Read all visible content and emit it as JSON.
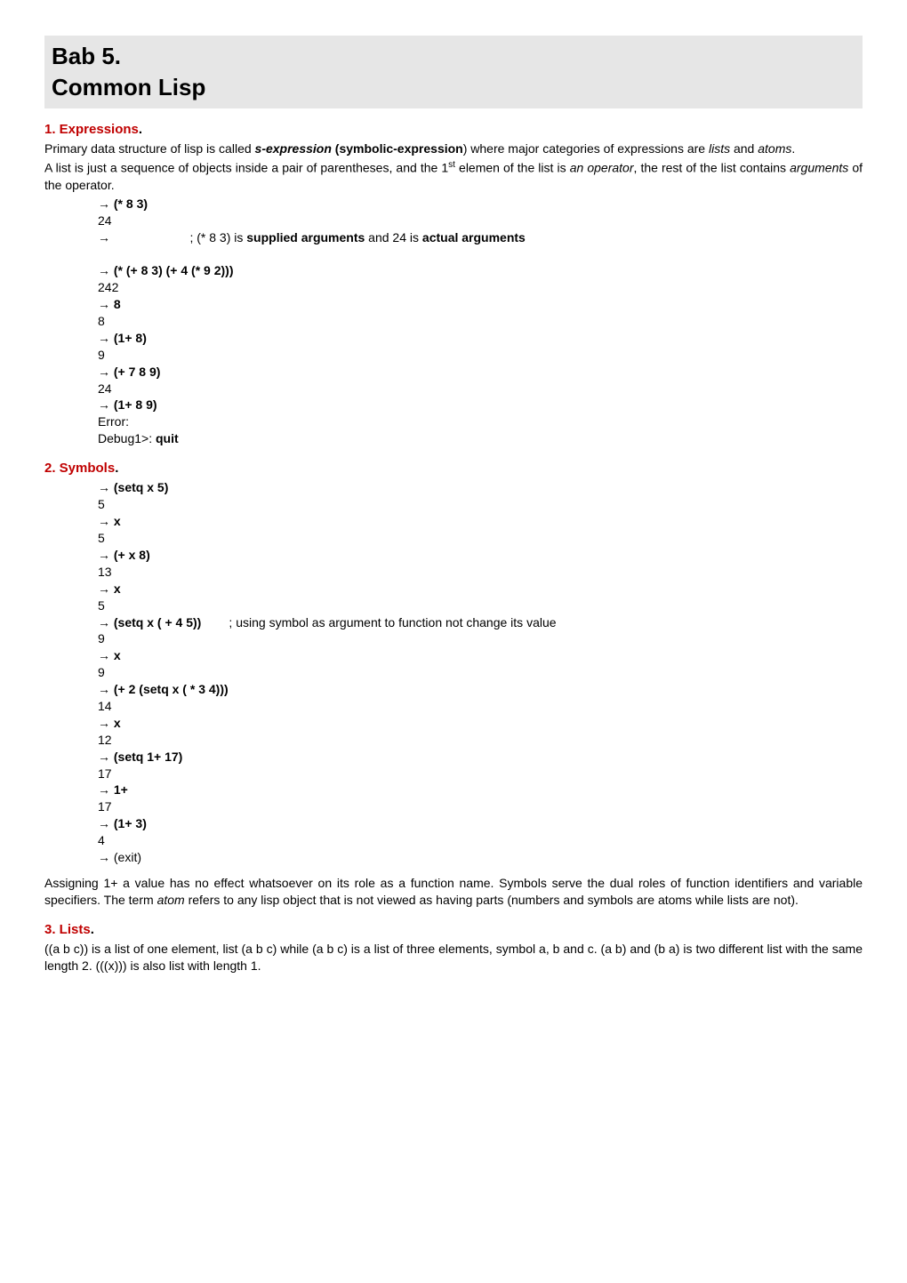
{
  "title": {
    "line1": "Bab 5.",
    "line2": "Common Lisp"
  },
  "s1": {
    "heading": "1. Expressions",
    "p1a": "Primary data structure of lisp is called ",
    "p1b": "s-expression",
    "p1c": " (symbolic-expression",
    "p1d": ") where major categories of expressions are ",
    "p1e": "lists",
    "p1f": " and ",
    "p1g": "atoms",
    "p1h": ".",
    "p2a": "A list is just a sequence of objects inside a pair of parentheses, and the 1",
    "p2b": "st",
    "p2c": " elemen of the list is ",
    "p2d": "an operator",
    "p2e": ", the rest of the list contains ",
    "p2f": "arguments",
    "p2g": " of the operator.",
    "code": [
      {
        "pre": "→ ",
        "b": "(* 8 3)",
        "post": ""
      },
      {
        "pre": "24",
        "b": "",
        "post": ""
      },
      {
        "pre": "→                       ; (* 8 3) is ",
        "b": "supplied arguments",
        "post": " and 24 is ",
        "b2": "actual arguments"
      },
      {
        "pre": "",
        "b": "",
        "post": ""
      },
      {
        "pre": "→ ",
        "b": "(* (+ 8 3) (+ 4 (* 9 2)))",
        "post": ""
      },
      {
        "pre": "242",
        "b": "",
        "post": ""
      },
      {
        "pre": "→ ",
        "b": "8",
        "post": ""
      },
      {
        "pre": "8",
        "b": "",
        "post": ""
      },
      {
        "pre": "→ ",
        "b": "(1+ 8)",
        "post": ""
      },
      {
        "pre": "9",
        "b": "",
        "post": ""
      },
      {
        "pre": "→ ",
        "b": "(+ 7 8 9)",
        "post": ""
      },
      {
        "pre": "24",
        "b": "",
        "post": ""
      },
      {
        "pre": "→ ",
        "b": "(1+ 8 9)",
        "post": ""
      },
      {
        "pre": "Error:",
        "b": "",
        "post": ""
      },
      {
        "pre": "Debug1>: ",
        "b": "quit",
        "post": ""
      }
    ]
  },
  "s2": {
    "heading": "2. Symbols",
    "code": [
      {
        "pre": "→ ",
        "b": "(setq x 5)",
        "post": ""
      },
      {
        "pre": "5",
        "b": "",
        "post": ""
      },
      {
        "pre": "→ ",
        "b": "x",
        "post": ""
      },
      {
        "pre": "5",
        "b": "",
        "post": ""
      },
      {
        "pre": "→ ",
        "b": "(+ x 8)",
        "post": ""
      },
      {
        "pre": "13",
        "b": "",
        "post": ""
      },
      {
        "pre": "→ ",
        "b": "x",
        "post": ""
      },
      {
        "pre": "5",
        "b": "",
        "post": ""
      },
      {
        "pre": "→ ",
        "b": "(setq x ( + 4 5))",
        "post": "        ; using symbol as argument to function not change its value"
      },
      {
        "pre": "9",
        "b": "",
        "post": ""
      },
      {
        "pre": "→ ",
        "b": "x",
        "post": ""
      },
      {
        "pre": "9",
        "b": "",
        "post": ""
      },
      {
        "pre": "→ ",
        "b": "(+ 2 (setq x ( * 3 4)))",
        "post": ""
      },
      {
        "pre": "14",
        "b": "",
        "post": ""
      },
      {
        "pre": "→ ",
        "b": "x",
        "post": ""
      },
      {
        "pre": "12",
        "b": "",
        "post": ""
      },
      {
        "pre": "→ ",
        "b": "(setq 1+ 17)",
        "post": ""
      },
      {
        "pre": "17",
        "b": "",
        "post": ""
      },
      {
        "pre": "→ ",
        "b": "1+",
        "post": ""
      },
      {
        "pre": "17",
        "b": "",
        "post": ""
      },
      {
        "pre": "→ ",
        "b": "(1+ 3)",
        "post": ""
      },
      {
        "pre": "4",
        "b": "",
        "post": ""
      },
      {
        "pre": "→ (exit)",
        "b": "",
        "post": ""
      }
    ],
    "p1a": "Assigning 1+ a value has no effect  whatsoever on its role as a function name. Symbols serve the dual roles of function identifiers and variable specifiers. The term ",
    "p1b": "atom",
    "p1c": " refers to any lisp object that is not viewed as having parts (numbers and symbols are atoms while lists are not)."
  },
  "s3": {
    "heading": "3. Lists",
    "p1": " ((a b c)) is a list of one element, list (a b c) while (a b c) is a list of three elements, symbol a, b and c. (a b) and (b a) is two different list with the same length 2. (((x))) is also list  with length 1."
  }
}
